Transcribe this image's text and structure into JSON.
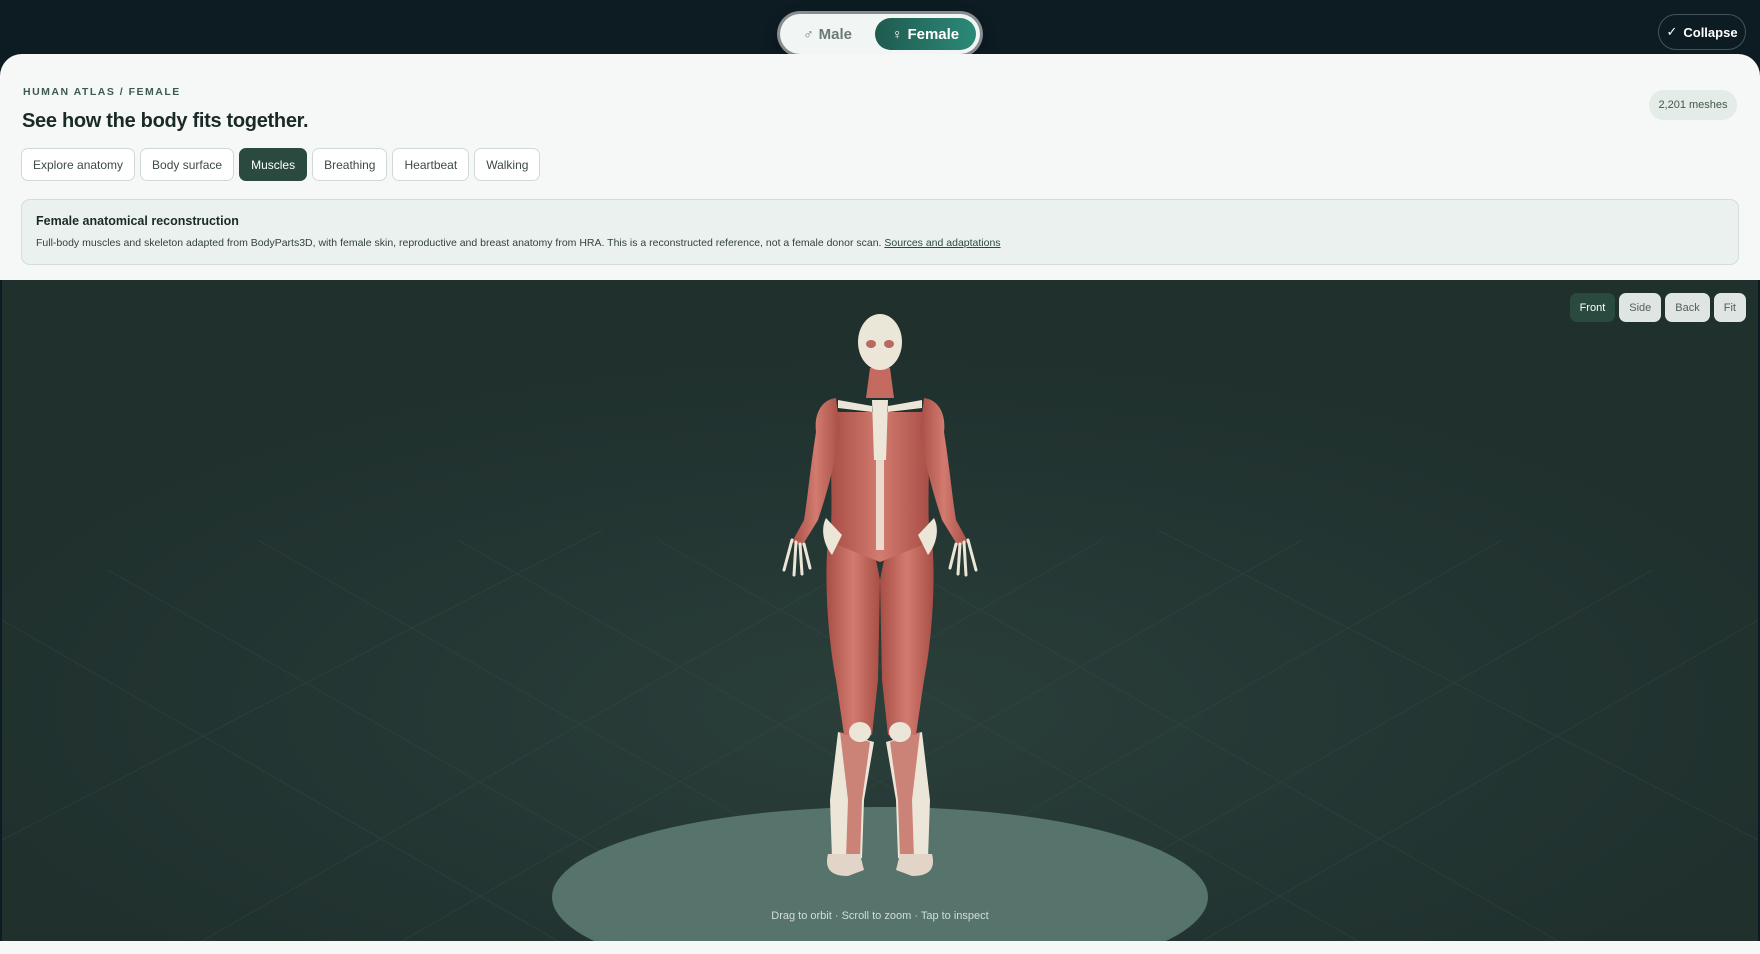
{
  "sex_toggle": {
    "male": {
      "label": "Male",
      "symbol": "♂"
    },
    "female": {
      "label": "Female",
      "symbol": "♀"
    },
    "selected": "female"
  },
  "collapse_button": {
    "label": "Collapse",
    "icon": "check-icon",
    "symbol": "✓"
  },
  "header": {
    "eyebrow": "HUMAN ATLAS / FEMALE",
    "title": "See how the body fits together.",
    "mesh_count": "2,201 meshes"
  },
  "tabs": [
    {
      "label": "Explore anatomy",
      "active": false
    },
    {
      "label": "Body surface",
      "active": false
    },
    {
      "label": "Muscles",
      "active": true
    },
    {
      "label": "Breathing",
      "active": false
    },
    {
      "label": "Heartbeat",
      "active": false
    },
    {
      "label": "Walking",
      "active": false
    }
  ],
  "info": {
    "title": "Female anatomical reconstruction",
    "text": "Full-body muscles and skeleton adapted from BodyParts3D, with female skin, reproductive and breast anatomy from HRA. This is a reconstructed reference, not a female donor scan.",
    "link": "Sources and adaptations"
  },
  "viewer": {
    "controls": [
      {
        "label": "Front",
        "active": true
      },
      {
        "label": "Side",
        "active": false
      },
      {
        "label": "Back",
        "active": false
      },
      {
        "label": "Fit",
        "active": false
      }
    ],
    "hint": "Drag to orbit · Scroll to zoom · Tap to inspect"
  },
  "colors": {
    "accent": "#2b4a3f",
    "dark_bg": "#0d1b22",
    "viewer_bg": "#1f302d",
    "muscle": "#c4675d",
    "bone": "#ece6d8"
  }
}
